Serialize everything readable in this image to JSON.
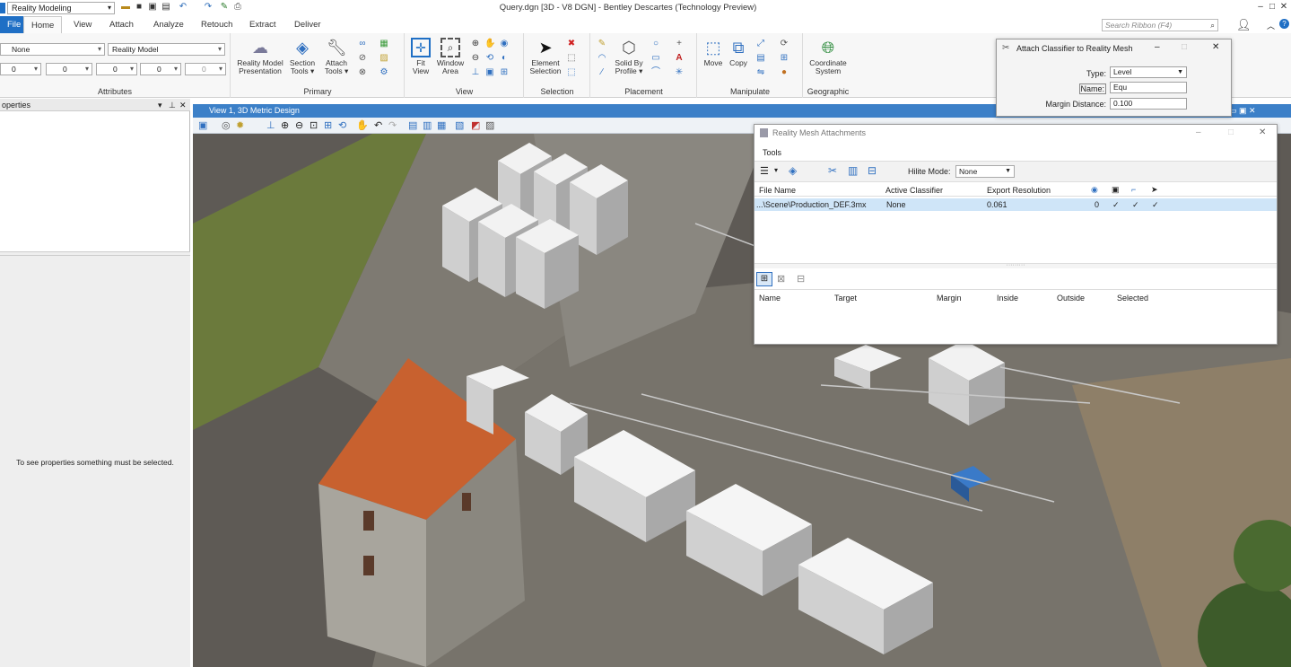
{
  "titlebar": {
    "workspace": "Reality Modeling",
    "document_title": "Query.dgn [3D - V8 DGN] - Bentley Descartes (Technology Preview)",
    "minimize": "–",
    "maximize": "□",
    "close": "✕"
  },
  "tabs": [
    "File",
    "Home",
    "View",
    "Attach",
    "Analyze",
    "Retouch",
    "Extract",
    "Deliver"
  ],
  "search": {
    "placeholder": "Search Ribbon (F4)"
  },
  "attributes": {
    "level": "None",
    "model": "Reality Model",
    "color": "0",
    "style": "0",
    "weight": "0",
    "transparency": "0",
    "priority": "0",
    "label": "Attributes"
  },
  "ribbon": {
    "primary": {
      "label": "Primary",
      "buttons": [
        "Reality Model\nPresentation",
        "Section\nTools ▾",
        "Attach\nTools ▾"
      ]
    },
    "view": {
      "label": "View",
      "buttons": [
        "Fit\nView",
        "Window\nArea"
      ]
    },
    "selection": {
      "label": "Selection",
      "buttons": [
        "Element\nSelection"
      ]
    },
    "placement": {
      "label": "Placement",
      "buttons": [
        "Solid By\nProfile ▾"
      ]
    },
    "manipulate": {
      "label": "Manipulate",
      "buttons": [
        "Move",
        "Copy"
      ]
    },
    "geographic": {
      "label": "Geographic",
      "buttons": [
        "Coordinate\nSystem"
      ]
    }
  },
  "properties": {
    "title": "operties",
    "message": "To see properties something must be selected."
  },
  "view": {
    "title": "View 1, 3D Metric Design"
  },
  "rma": {
    "title": "Reality Mesh Attachments",
    "menu": "Tools",
    "hilite_label": "Hilite Mode:",
    "hilite_value": "None",
    "columns": [
      "File Name",
      "Active Classifier",
      "Export Resolution"
    ],
    "rows": [
      {
        "file": "...\\Scene\\Production_DEF.3mx",
        "classifier": "None",
        "resolution": "0.061",
        "c4": "0",
        "c5": "✓",
        "c6": "✓",
        "c7": "✓"
      }
    ],
    "classifier_columns": [
      "Name",
      "Target",
      "Margin",
      "Inside",
      "Outside",
      "Selected"
    ]
  },
  "attach_dialog": {
    "title": "Attach Classifier to Reality Mesh",
    "type_label": "Type:",
    "type_value": "Level",
    "name_label": "Name:",
    "name_value": "Equ",
    "margin_label": "Margin Distance:",
    "margin_value": "0.100"
  }
}
